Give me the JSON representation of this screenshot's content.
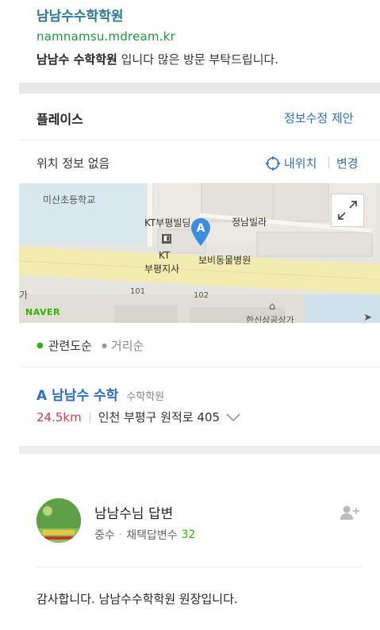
{
  "header": {
    "name": "남남수수학학원",
    "url": "namnamsu.mdream.kr",
    "desc_bold": "남남수 수학학원",
    "desc_rest": " 입니다 많은 방문 부탁드립니다."
  },
  "place": {
    "section_title": "플레이스",
    "suggest_link": "정보수정 제안",
    "location_none": "위치 정보 없음",
    "my_location": "내위치",
    "change": "변경",
    "map": {
      "labels": {
        "school": "미산초등학교",
        "kt_bldg": "KT부평빌딩",
        "villa": "정남빌라",
        "kt_branch_1": "KT",
        "kt_branch_2": "부평지사",
        "hospital": "보비동물병원",
        "num_101": "101",
        "num_102": "102",
        "left_edge": "가",
        "bottom": "한신상공상가",
        "naver": "NAVER",
        "marker": "A"
      }
    },
    "sort": {
      "relevance": "관련도순",
      "distance": "거리순"
    },
    "result": {
      "marker": "A",
      "name": "남남수 수학",
      "category": "수학학원",
      "distance": "24.5km",
      "address": "인천 부평구 원적로 405"
    }
  },
  "answer": {
    "author": "남남수님 답변",
    "rank": "중수",
    "count_label": "채택답변수",
    "count": "32",
    "body": "감사합니다. 남남수수학학원 원장입니다."
  },
  "colors": {
    "link_blue": "#2a7a9c",
    "url_green": "#1b9a3a",
    "accent_blue": "#2b6fc7",
    "distance_red": "#e0394b",
    "naver_green": "#2db400"
  },
  "icons": {
    "my_location": "crosshair-icon",
    "expand": "expand-arrows-icon",
    "add_friend": "add-person-icon",
    "dropdown": "chevron-down-icon",
    "marker": "map-pin-icon"
  }
}
